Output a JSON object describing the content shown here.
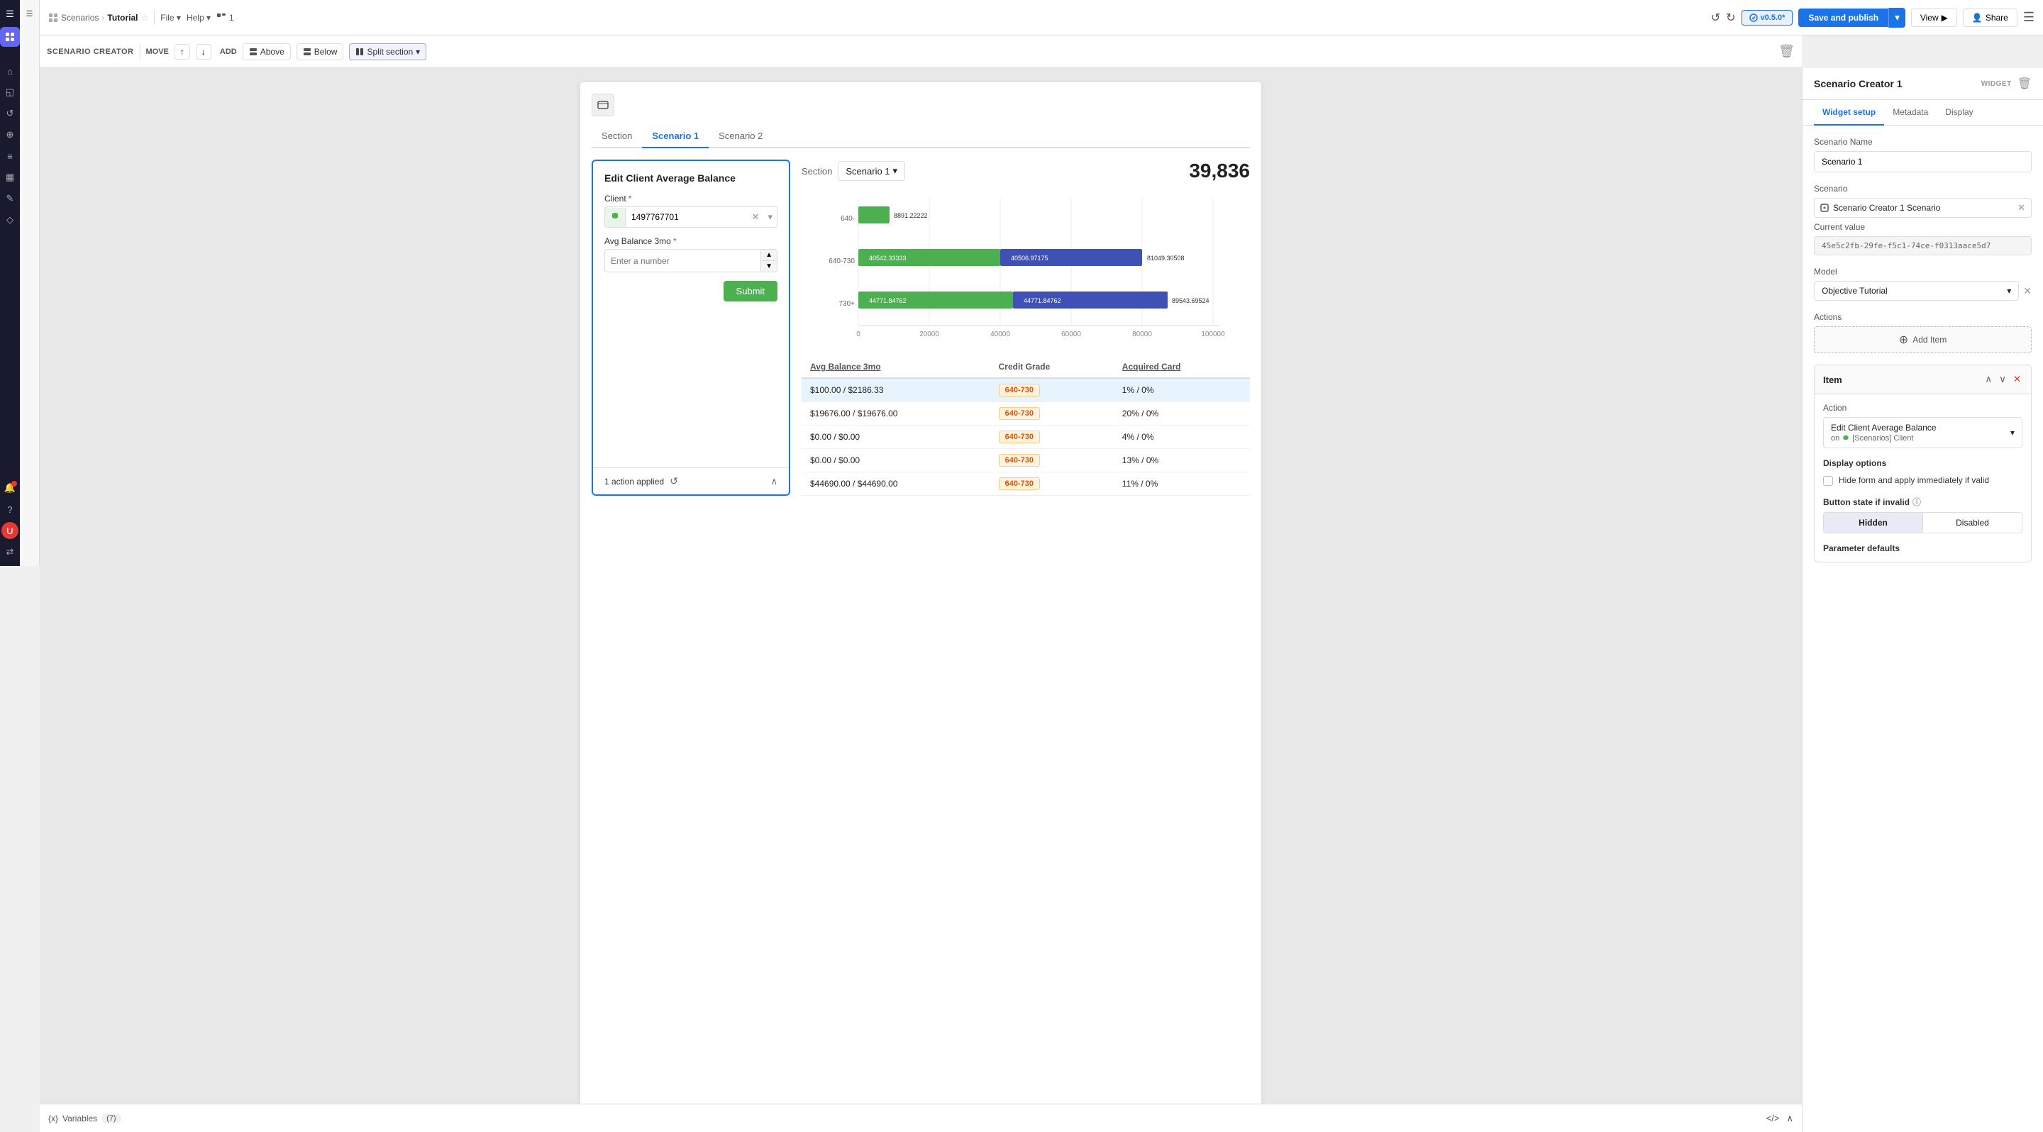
{
  "topbar": {
    "breadcrumb_parent": "Scenarios",
    "breadcrumb_current": "Tutorial",
    "version": "v0.5.0*",
    "save_publish": "Save and publish",
    "view": "View",
    "share": "Share"
  },
  "toolbar": {
    "label": "SCENARIO CREATOR",
    "move": "MOVE",
    "add": "ADD",
    "above": "Above",
    "below": "Below",
    "split_section": "Split section"
  },
  "tabs": {
    "section": "Section",
    "scenario1": "Scenario 1",
    "scenario2": "Scenario 2"
  },
  "form": {
    "title": "Edit Client Average Balance",
    "client_label": "Client",
    "client_value": "1497767701",
    "avg_balance_label": "Avg Balance 3mo",
    "avg_balance_placeholder": "Enter a number",
    "submit": "Submit",
    "action_applied": "1 action applied"
  },
  "chart": {
    "section_label": "Section",
    "scenario_label": "Scenario 1",
    "chart_value": "39,836",
    "bars": [
      {
        "label": "640-",
        "val1": 8891.22222,
        "val2": 0,
        "total": "8891.22222",
        "y": 0,
        "w1": 85,
        "w2": 0
      },
      {
        "label": "640-730",
        "val1": 40542.33333,
        "val2": 40506.97175,
        "total": "81049.30508",
        "y": 1,
        "w1": 390,
        "w2": 390
      },
      {
        "label": "730+",
        "val1": 44771.84762,
        "val2": 44771.84762,
        "total": "89543.69524",
        "y": 2,
        "w1": 430,
        "w2": 430
      }
    ],
    "x_labels": [
      "20000",
      "40000",
      "60000",
      "80000",
      "100000"
    ]
  },
  "table": {
    "col1": "Avg Balance 3mo",
    "col2": "Credit Grade",
    "col3": "Acquired Card",
    "rows": [
      {
        "balance": "$100.00 / $2186.33",
        "grade": "640-730",
        "acquired": "1% / 0%",
        "highlighted": true
      },
      {
        "balance": "$19676.00 / $19676.00",
        "grade": "640-730",
        "acquired": "20% / 0%",
        "highlighted": false
      },
      {
        "balance": "$0.00 / $0.00",
        "grade": "640-730",
        "acquired": "4% / 0%",
        "highlighted": false
      },
      {
        "balance": "$0.00 / $0.00",
        "grade": "640-730",
        "acquired": "13% / 0%",
        "highlighted": false
      },
      {
        "balance": "$44690.00 / $44690.00",
        "grade": "640-730",
        "acquired": "11% / 0%",
        "highlighted": false
      }
    ]
  },
  "right_panel": {
    "title": "Scenario Creator 1",
    "widget_label": "WIDGET",
    "tabs": {
      "widget_setup": "Widget setup",
      "metadata": "Metadata",
      "display": "Display"
    },
    "scenario_name_label": "Scenario Name",
    "scenario_name_value": "Scenario 1",
    "scenario_label": "Scenario",
    "scenario_value": "Scenario Creator 1 Scenario",
    "current_value_label": "Current value",
    "current_value": "45e5c2fb-29fe-f5c1-74ce-f0313aace5d7",
    "model_label": "Model",
    "model_value": "Objective Tutorial",
    "actions_label": "Actions",
    "add_item": "Add Item",
    "item_label": "Item",
    "action_label": "Action",
    "action_name": "Edit Client Average Balance",
    "action_sub": "on",
    "action_sub2": "[Scenarios] Client",
    "display_options_label": "Display options",
    "hide_form_label": "Hide form and apply immediately if valid",
    "button_state_label": "Button state if invalid",
    "button_hidden": "Hidden",
    "button_disabled": "Disabled",
    "param_defaults": "Parameter defaults"
  },
  "bottom_bar": {
    "variables": "Variables",
    "count": "(7)"
  },
  "left_sidebar": {
    "items": [
      {
        "icon": "☰",
        "name": "menu"
      },
      {
        "icon": "⊞",
        "name": "grid"
      },
      {
        "icon": "◷",
        "name": "history"
      },
      {
        "icon": "⚙",
        "name": "settings"
      },
      {
        "icon": "🔍",
        "name": "search"
      },
      {
        "icon": "☰",
        "name": "list"
      },
      {
        "icon": "📊",
        "name": "chart"
      },
      {
        "icon": "✎",
        "name": "edit"
      },
      {
        "icon": "◇",
        "name": "diamond"
      },
      {
        "icon": "🔔",
        "name": "bell"
      },
      {
        "icon": "?",
        "name": "help"
      },
      {
        "icon": "⚡",
        "name": "lightning"
      },
      {
        "icon": "⇄",
        "name": "arrows"
      }
    ]
  }
}
